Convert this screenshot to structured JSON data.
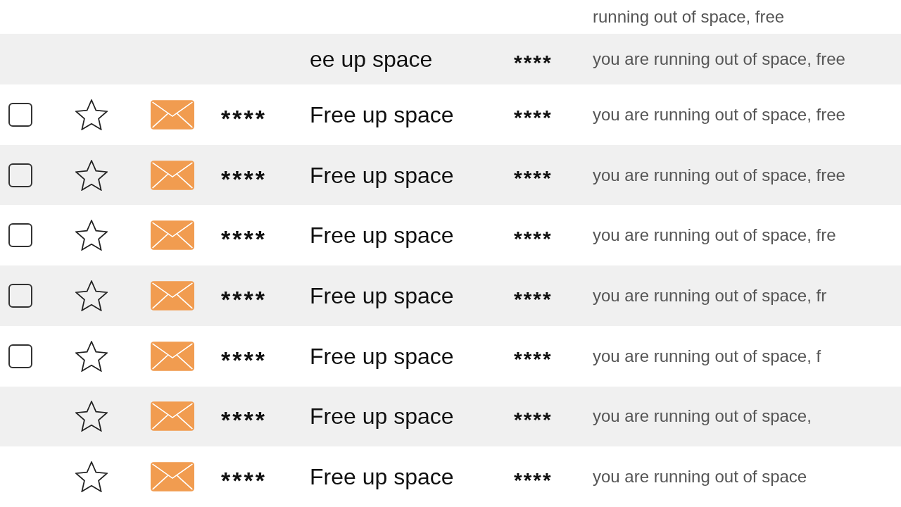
{
  "inbox": {
    "rows": [
      {
        "preview": "running out of space, free"
      },
      {
        "subject": "ee up space",
        "column_6": "****",
        "preview": "you are running out of space, free"
      },
      {
        "checked": false,
        "starred": false,
        "sender": "****",
        "subject": "Free up space",
        "column_6": "****",
        "preview": "you are running out of space, free"
      },
      {
        "checked": false,
        "starred": false,
        "sender": "****",
        "subject": "Free up space",
        "column_6": "****",
        "preview": "you are running out of space, free"
      },
      {
        "checked": false,
        "starred": false,
        "sender": "****",
        "subject": "Free up space",
        "column_6": "****",
        "preview": "you are running out of space, fre"
      },
      {
        "checked": false,
        "starred": false,
        "sender": "****",
        "subject": "Free up space",
        "column_6": "****",
        "preview": "you are running out of space, fr"
      },
      {
        "checked": false,
        "starred": false,
        "sender": "****",
        "subject": "Free up space",
        "column_6": "****",
        "preview": "you are running out of space, f"
      },
      {
        "starred": false,
        "sender": "****",
        "subject": "Free up space",
        "column_6": "****",
        "preview": "you are running out of space,"
      },
      {
        "starred": false,
        "sender": "****",
        "subject": "Free up space",
        "column_6": "****",
        "preview": "you are running out of space"
      }
    ]
  }
}
